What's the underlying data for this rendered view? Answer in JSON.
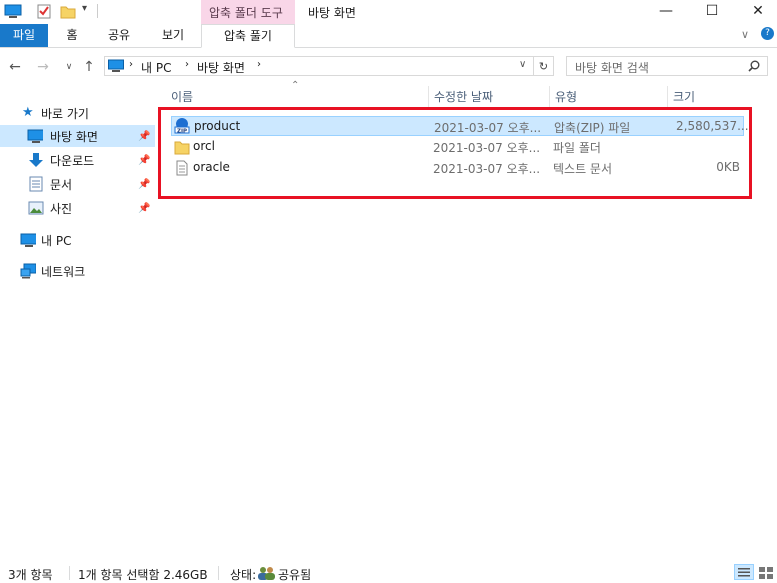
{
  "colors": {
    "accent": "#1979ca",
    "context_tab": "#f9d6e8",
    "selection": "#cce8ff",
    "highlight_box": "#e81123"
  },
  "window": {
    "title": "바탕 화면",
    "context_tab_group": "압축 폴더 도구"
  },
  "ribbon": {
    "tabs": [
      "파일",
      "홈",
      "공유",
      "보기",
      "압축 풀기"
    ]
  },
  "address": {
    "path": [
      "내 PC",
      "바탕 화면"
    ],
    "search_placeholder": "바탕 화면 검색"
  },
  "nav": {
    "quick_access": "바로 가기",
    "items": [
      {
        "label": "바탕 화면",
        "icon": "desktop-icon",
        "selected": true
      },
      {
        "label": "다운로드",
        "icon": "download-icon"
      },
      {
        "label": "문서",
        "icon": "document-icon"
      },
      {
        "label": "사진",
        "icon": "pictures-icon"
      }
    ],
    "this_pc": "내 PC",
    "network": "네트워크"
  },
  "columns": [
    "이름",
    "수정한 날짜",
    "유형",
    "크기"
  ],
  "files": [
    {
      "name": "product",
      "date": "2021-03-07 오후...",
      "type": "압축(ZIP) 파일",
      "size": "2,580,537...",
      "icon": "zip-icon",
      "selected": true
    },
    {
      "name": "orcl",
      "date": "2021-03-07 오후...",
      "type": "파일 폴더",
      "size": "",
      "icon": "folder-icon"
    },
    {
      "name": "oracle",
      "date": "2021-03-07 오후...",
      "type": "텍스트 문서",
      "size": "0KB",
      "icon": "text-file-icon"
    }
  ],
  "status": {
    "count": "3개 항목",
    "selection": "1개 항목 선택함 2.46GB",
    "state_label": "상태:",
    "state_value": "공유됨"
  }
}
